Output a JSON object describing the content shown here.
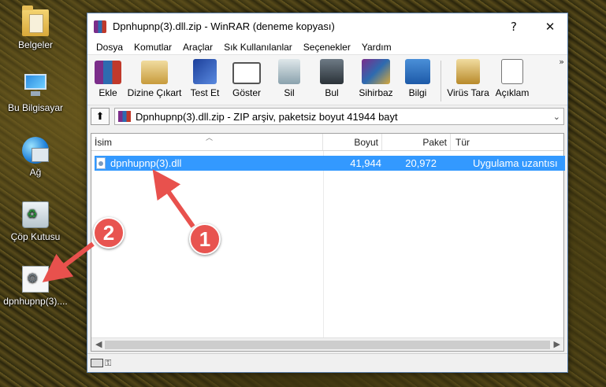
{
  "desktop": {
    "icons": [
      {
        "label": "Belgeler",
        "icon": "folder-icon"
      },
      {
        "label": "Bu Bilgisayar",
        "icon": "computer-icon"
      },
      {
        "label": "Ağ",
        "icon": "network-icon"
      },
      {
        "label": "Çöp Kutusu",
        "icon": "recycle-bin-icon"
      },
      {
        "label": "dpnhupnp(3)....",
        "icon": "dll-file-icon"
      }
    ]
  },
  "window": {
    "title": "Dpnhupnp(3).dll.zip - WinRAR (deneme kopyası)",
    "help_btn": "?",
    "close_btn": "✕",
    "menu": [
      "Dosya",
      "Komutlar",
      "Araçlar",
      "Sık Kullanılanlar",
      "Seçenekler",
      "Yardım"
    ],
    "toolbar": [
      {
        "label": "Ekle",
        "icon": "add-icon"
      },
      {
        "label": "Dizine Çıkart",
        "icon": "extract-icon"
      },
      {
        "label": "Test Et",
        "icon": "test-icon"
      },
      {
        "label": "Göster",
        "icon": "view-icon"
      },
      {
        "label": "Sil",
        "icon": "delete-icon"
      },
      {
        "label": "Bul",
        "icon": "find-icon"
      },
      {
        "label": "Sihirbaz",
        "icon": "wizard-icon"
      },
      {
        "label": "Bilgi",
        "icon": "info-icon"
      },
      {
        "label": "Virüs Tara",
        "icon": "virus-scan-icon"
      },
      {
        "label": "Açıklam",
        "icon": "comment-icon"
      }
    ],
    "toolbar_more": "»",
    "path": "Dpnhupnp(3).dll.zip - ZIP arşiv, paketsiz boyut 41944 bayt",
    "columns": {
      "name": "İsim",
      "size": "Boyut",
      "packed": "Paket",
      "type": "Tür"
    },
    "files": [
      {
        "name": "dpnhupnp(3).dll",
        "size": "41,944",
        "packed": "20,972",
        "type": "Uygulama uzantısı"
      }
    ]
  },
  "annotations": {
    "badge1": "1",
    "badge2": "2"
  },
  "colors": {
    "selection": "#3399ff",
    "badge": "#e85450",
    "arrow": "#e8514d"
  }
}
